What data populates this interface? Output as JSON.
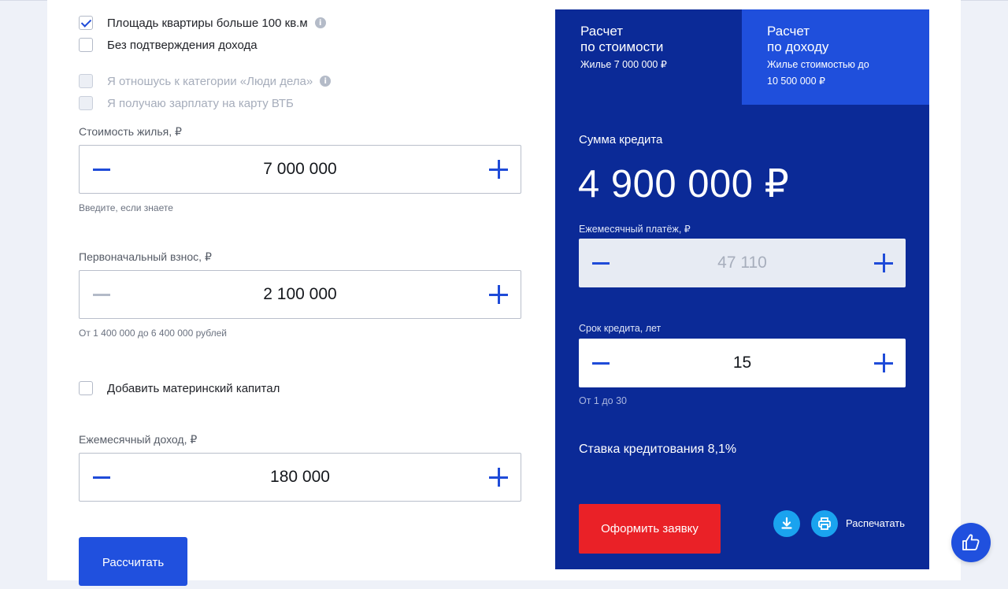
{
  "checkboxes": [
    {
      "label": "Площадь квартиры больше 100 кв.м",
      "checked": true,
      "disabled": false
    },
    {
      "label": "Без подтверждения дохода",
      "checked": false,
      "disabled": false
    },
    {
      "label": "Я отношусь к категории «Люди дела»",
      "checked": false,
      "disabled": true
    },
    {
      "label": "Я получаю зарплату на карту ВТБ",
      "checked": false,
      "disabled": true
    }
  ],
  "property_cost": {
    "label": "Стоимость жилья, ₽",
    "value": "7 000 000",
    "hint": "Введите, если знаете"
  },
  "down_payment": {
    "label": "Первоначальный взнос, ₽",
    "value": "2 100 000",
    "hint": "От 1 400 000 до 6 400 000 рублей"
  },
  "maternity_capital": {
    "label": "Добавить материнский капитал",
    "checked": false
  },
  "monthly_income": {
    "label": "Ежемесячный доход, ₽",
    "value": "180 000"
  },
  "calculate_button": "Рассчитать",
  "tabs": [
    {
      "title_line1": "Расчет",
      "title_line2": "по стоимости",
      "subtitle": "Жилье 7 000 000 ₽",
      "active": true
    },
    {
      "title_line1": "Расчет",
      "title_line2": "по доходу",
      "subtitle_line1": "Жилье стоимостью до",
      "subtitle_line2": "10 500 000 ₽",
      "active": false
    }
  ],
  "loan": {
    "sum_label": "Сумма кредита",
    "sum_value": "4 900 000 ₽",
    "monthly_payment_label": "Ежемесячный платёж, ₽",
    "monthly_payment_value": "47 110",
    "term_label": "Срок кредита, лет",
    "term_value": "15",
    "term_hint": "От 1 до 30",
    "rate_text": "Ставка кредитования 8,1%"
  },
  "apply_button": "Оформить заявку",
  "print_label": "Распечатать",
  "colors": {
    "panel": "#0b2a97",
    "tab_active_alt": "#1f4fdc",
    "accent": "#1f4bd8",
    "apply": "#ea2127",
    "icon_circle": "#1aa3ef"
  },
  "icons": [
    "info-icon",
    "minus-icon",
    "plus-icon",
    "download-icon",
    "print-icon",
    "thumbs-up-icon"
  ]
}
